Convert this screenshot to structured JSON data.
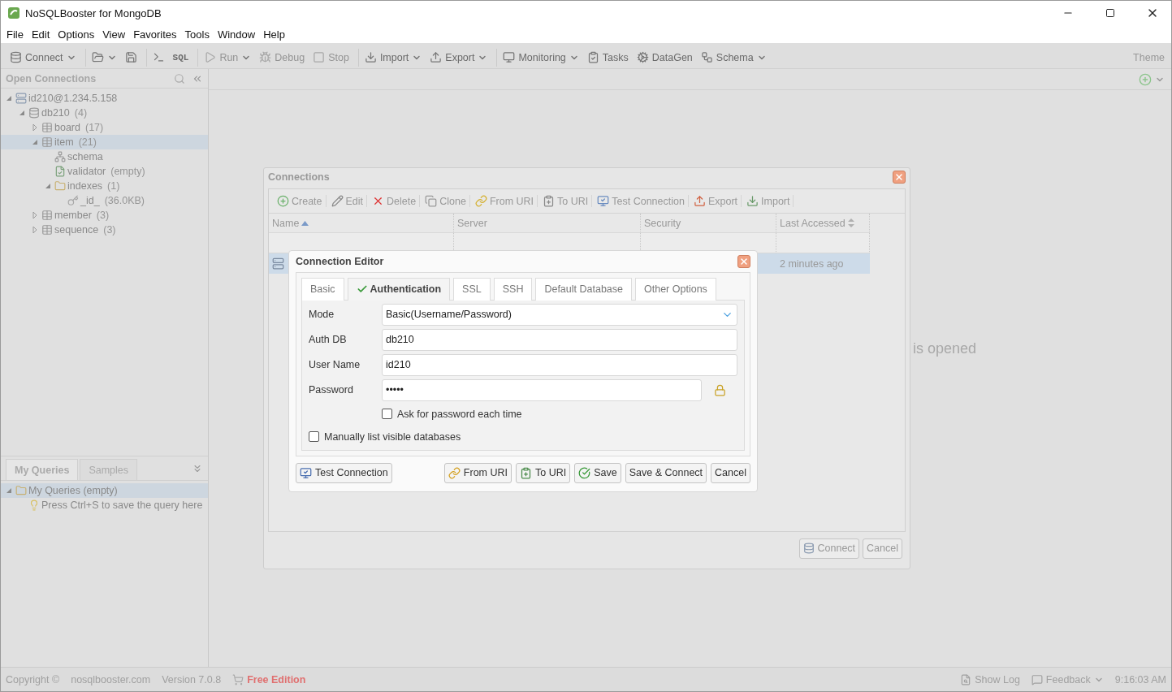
{
  "window": {
    "title": "NoSQLBooster for MongoDB"
  },
  "menu": [
    "File",
    "Edit",
    "Options",
    "View",
    "Favorites",
    "Tools",
    "Window",
    "Help"
  ],
  "toolbar": {
    "groups": [
      [
        {
          "label": "Connect",
          "dropdown": true,
          "disabled": false
        }
      ],
      [
        {
          "dropdown": true,
          "disabled": false
        },
        {
          "dropdown": false,
          "disabled": false
        }
      ],
      [
        {
          "dropdown": false,
          "disabled": false
        },
        {
          "label": "SQL",
          "dropdown": false,
          "disabled": false
        }
      ],
      [
        {
          "label": "Run",
          "dropdown": true,
          "disabled": true
        },
        {
          "label": "Debug",
          "dropdown": false,
          "disabled": true
        },
        {
          "label": "Stop",
          "dropdown": false,
          "disabled": true
        }
      ],
      [
        {
          "label": "Import",
          "dropdown": true,
          "disabled": false
        },
        {
          "label": "Export",
          "dropdown": true,
          "disabled": false
        }
      ],
      [
        {
          "label": "Monitoring",
          "dropdown": true,
          "disabled": false
        },
        {
          "label": "Tasks",
          "dropdown": false,
          "disabled": false
        },
        {
          "label": "DataGen",
          "dropdown": false,
          "disabled": false
        },
        {
          "label": "Schema",
          "dropdown": true,
          "disabled": false
        }
      ]
    ],
    "theme": "Theme"
  },
  "sidebar": {
    "title": "Open Connections",
    "tree": [
      {
        "label": "id210@1.234.5.158",
        "kind": "server",
        "expanded": true,
        "selected": false,
        "children": [
          {
            "label": "db210",
            "count": "(4)",
            "kind": "database",
            "expanded": true,
            "selected": false,
            "children": [
              {
                "label": "board",
                "count": "(17)",
                "kind": "collection",
                "expanded": false,
                "selected": false
              },
              {
                "label": "item",
                "count": "(21)",
                "kind": "collection",
                "expanded": true,
                "selected": true,
                "children": [
                  {
                    "label": "schema",
                    "kind": "schema",
                    "selected": false
                  },
                  {
                    "label": "validator",
                    "count": "(empty)",
                    "kind": "validator",
                    "selected": false
                  },
                  {
                    "label": "indexes",
                    "count": "(1)",
                    "kind": "folder",
                    "expanded": true,
                    "selected": false,
                    "children": [
                      {
                        "label": "_id_",
                        "count": "(36.0KB)",
                        "kind": "index",
                        "selected": false
                      }
                    ]
                  }
                ]
              },
              {
                "label": "member",
                "count": "(3)",
                "kind": "collection",
                "expanded": false,
                "selected": false
              },
              {
                "label": "sequence",
                "count": "(3)",
                "kind": "collection",
                "expanded": false,
                "selected": false
              }
            ]
          }
        ]
      }
    ],
    "query_tabs": [
      {
        "label": "My Queries",
        "selected": true
      },
      {
        "label": "Samples",
        "selected": false
      }
    ],
    "query_tree": [
      {
        "label": "My Queries (empty)",
        "kind": "folder",
        "expanded": true,
        "selected": true,
        "children": [
          {
            "label": "Press Ctrl+S to save the query here",
            "kind": "hint",
            "selected": false
          }
        ]
      }
    ]
  },
  "main": {
    "message": "is opened"
  },
  "connections": {
    "title": "Connections",
    "toolbar": [
      {
        "label": "Create"
      },
      {
        "label": "Edit"
      },
      {
        "label": "Delete"
      },
      {
        "label": "Clone"
      },
      {
        "label": "From URI"
      },
      {
        "label": "To URI"
      },
      {
        "label": "Test Connection"
      },
      {
        "label": "Export"
      },
      {
        "label": "Import"
      }
    ],
    "columns": [
      {
        "label": "Name",
        "sortable": true,
        "sorted": true
      },
      {
        "label": "Server",
        "sortable": false,
        "sorted": false
      },
      {
        "label": "Security",
        "sortable": false,
        "sorted": false
      },
      {
        "label": "Last Accessed",
        "sortable": true,
        "sorted": false
      }
    ],
    "rows": [
      {
        "last_accessed": "2 minutes ago",
        "selected": true
      }
    ],
    "buttons": [
      "Connect",
      "Cancel"
    ]
  },
  "editor": {
    "title": "Connection Editor",
    "tabs": [
      {
        "label": "Basic",
        "selected": false,
        "valid": false
      },
      {
        "label": "Authentication",
        "selected": true,
        "valid": true
      },
      {
        "label": "SSL",
        "selected": false,
        "valid": false
      },
      {
        "label": "SSH",
        "selected": false,
        "valid": false
      },
      {
        "label": "Default Database",
        "selected": false,
        "valid": false
      },
      {
        "label": "Other Options",
        "selected": false,
        "valid": false
      }
    ],
    "fields": [
      {
        "label": "Mode",
        "value": "Basic(Username/Password)",
        "kind": "select"
      },
      {
        "label": "Auth DB",
        "value": "db210",
        "kind": "text"
      },
      {
        "label": "User Name",
        "value": "id210",
        "kind": "text"
      },
      {
        "label": "Password",
        "value": "•••••",
        "kind": "password"
      }
    ],
    "ask_password": {
      "label": "Ask for password each time",
      "checked": false
    },
    "manual_list": {
      "label": "Manually list visible databases",
      "checked": false
    },
    "buttons": [
      "Test Connection",
      "From URI",
      "To URI",
      "Save",
      "Save & Connect",
      "Cancel"
    ]
  },
  "status_bar": {
    "copyright": "Copyright ©",
    "site": "nosqlbooster.com",
    "version": "Version 7.0.8",
    "edition": "Free Edition",
    "show_log": "Show Log",
    "feedback": "Feedback",
    "time": "9:16:03 AM"
  }
}
